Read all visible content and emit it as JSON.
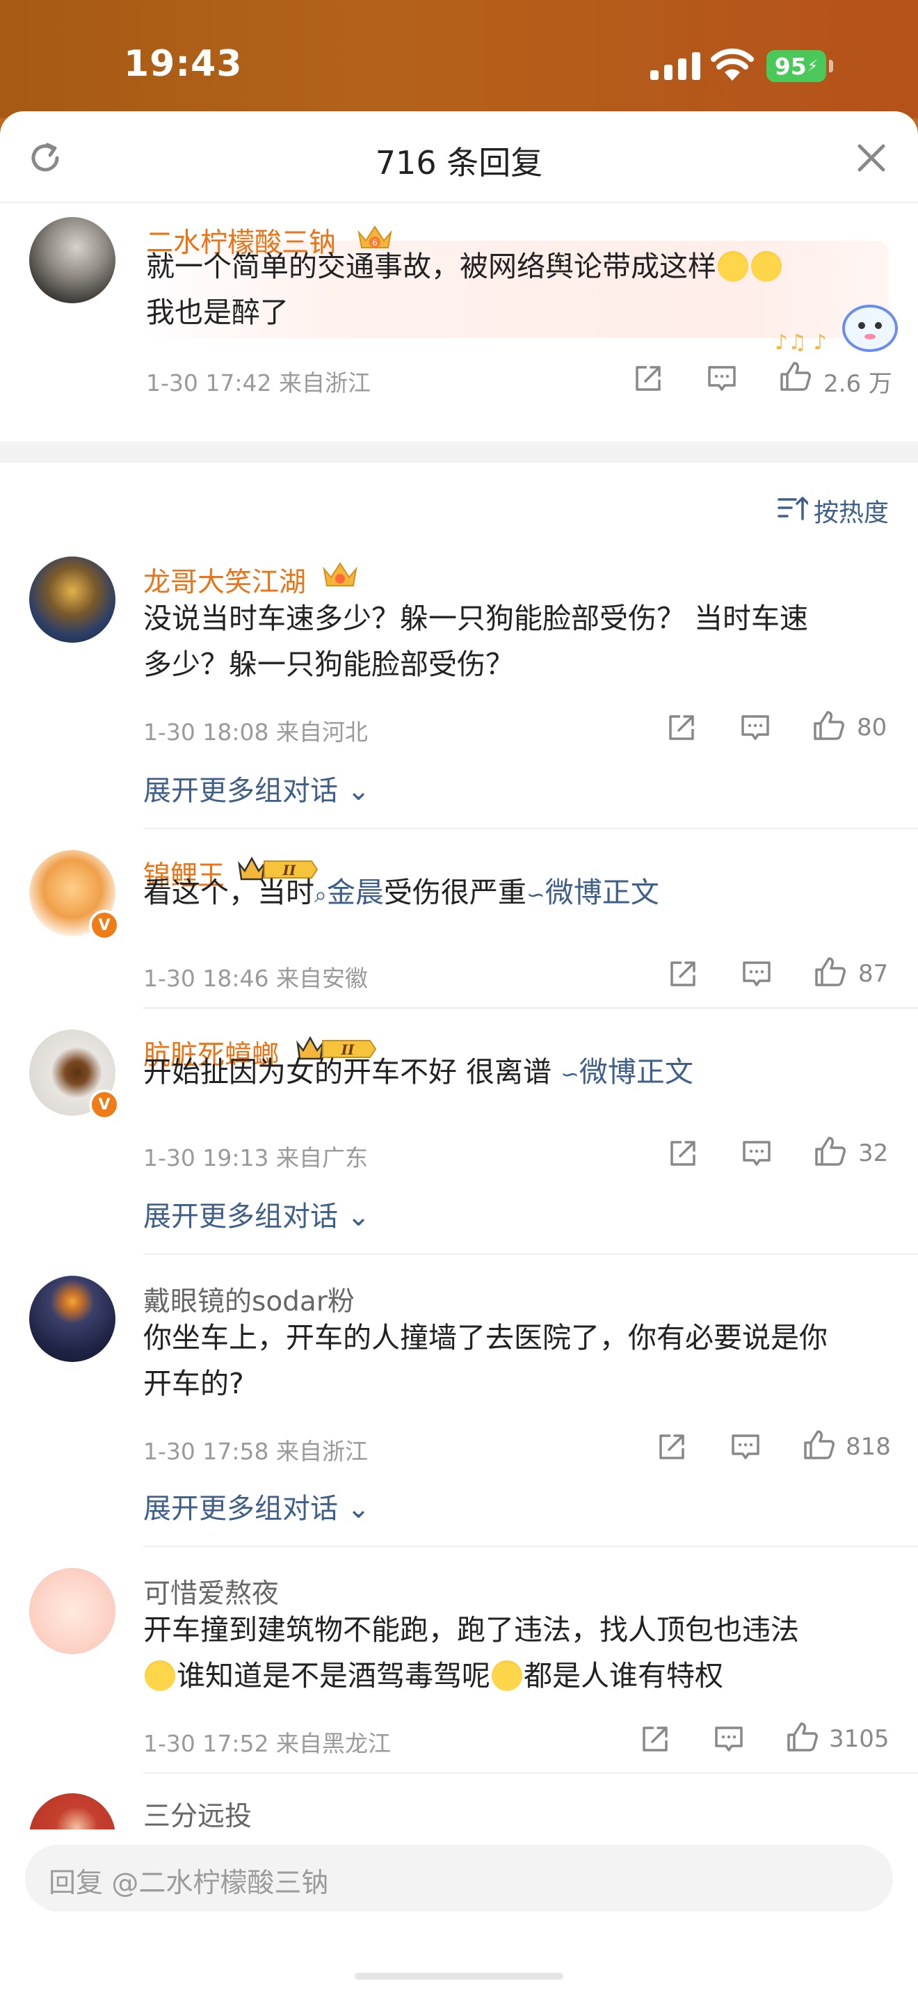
{
  "status": {
    "time": "19:43",
    "battery": "95"
  },
  "sheet": {
    "title": "716 条回复"
  },
  "root_comment": {
    "name": "二水柠檬酸三钠",
    "text_line1": "就一个简单的交通事故，被网络舆论带成这样",
    "text_line2": "我也是醉了",
    "meta": "1-30 17:42  来自浙江",
    "likes": "2.6 万"
  },
  "sort": {
    "label": "按热度"
  },
  "comments": [
    {
      "name": "龙哥大笑江湖",
      "text_line1": "没说当时车速多少？躲一只狗能脸部受伤？ 当时车速",
      "text_line2": "多少？躲一只狗能脸部受伤？",
      "meta": "1-30 18:08  来自河北",
      "likes": "80",
      "expand": "展开更多组对话"
    },
    {
      "name": "锦鲤王",
      "level": "II",
      "text_prefix": "看这个，当时",
      "topic": "金晨",
      "text_mid": "受伤很严重",
      "link": "微博正文",
      "meta": "1-30 18:46  来自安徽",
      "likes": "87"
    },
    {
      "name": "肮脏死蟑螂",
      "level": "II",
      "text_prefix": "开始扯因为女的开车不好 很离谱 ",
      "link": "微博正文",
      "meta": "1-30 19:13  来自广东",
      "likes": "32",
      "expand": "展开更多组对话"
    },
    {
      "name": "戴眼镜的sodar粉",
      "text_line1": "你坐车上，开车的人撞墙了去医院了，你有必要说是你",
      "text_line2": "开车的?",
      "meta": "1-30 17:58  来自浙江",
      "likes": "818",
      "expand": "展开更多组对话"
    },
    {
      "name": "可惜爱熬夜",
      "text_line1": "开车撞到建筑物不能跑，跑了违法，找人顶包也违法",
      "text_line2_a": "谁知道是不是酒驾毒驾呢",
      "text_line2_b": "都是人谁有特权",
      "meta": "1-30 17:52  来自黑龙江",
      "likes": "3105"
    },
    {
      "name": "三分远投"
    }
  ],
  "reply_bar": {
    "placeholder": "回复 @二水柠檬酸三钠"
  },
  "colors": {
    "name_orange": "#eb7316",
    "link_blue": "#3e5f8a"
  }
}
